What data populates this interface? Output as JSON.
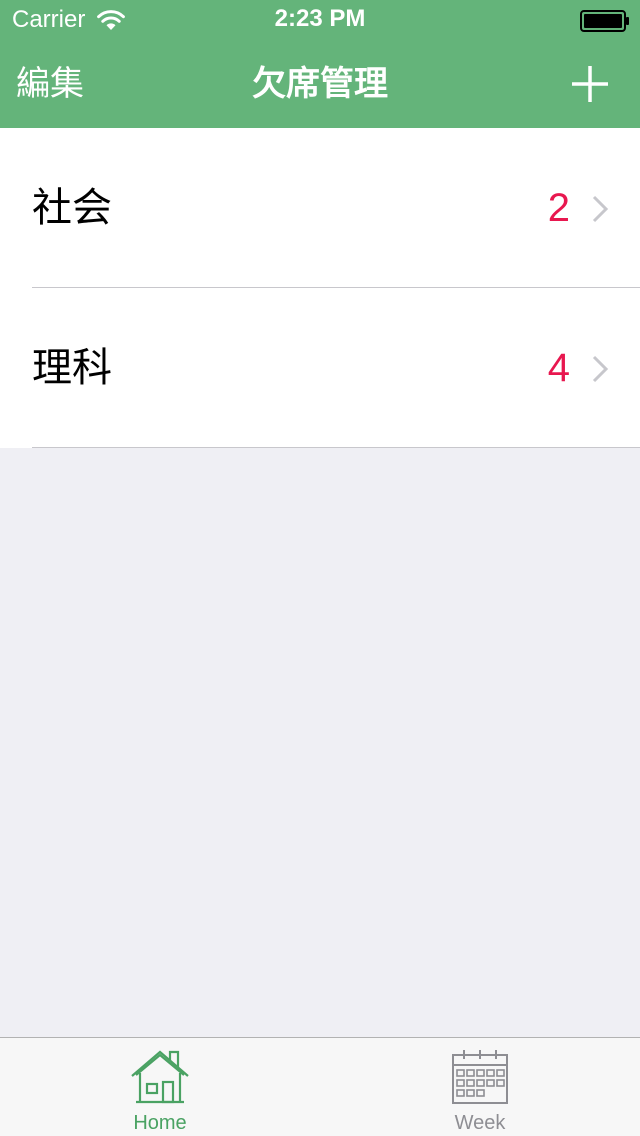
{
  "status_bar": {
    "carrier": "Carrier",
    "time": "2:23 PM"
  },
  "nav": {
    "edit_label": "編集",
    "title": "欠席管理",
    "add_icon": "plus-icon"
  },
  "subjects": [
    {
      "name": "社会",
      "count": "2"
    },
    {
      "name": "理科",
      "count": "4"
    }
  ],
  "tabs": [
    {
      "label": "Home",
      "icon": "home-icon",
      "selected": true
    },
    {
      "label": "Week",
      "icon": "calendar-icon",
      "selected": false
    }
  ],
  "colors": {
    "accent": "#64b47a",
    "count": "#e8174f",
    "tab_selected": "#4aa263",
    "tab_unselected": "#8e8e93",
    "background": "#efeff4"
  }
}
